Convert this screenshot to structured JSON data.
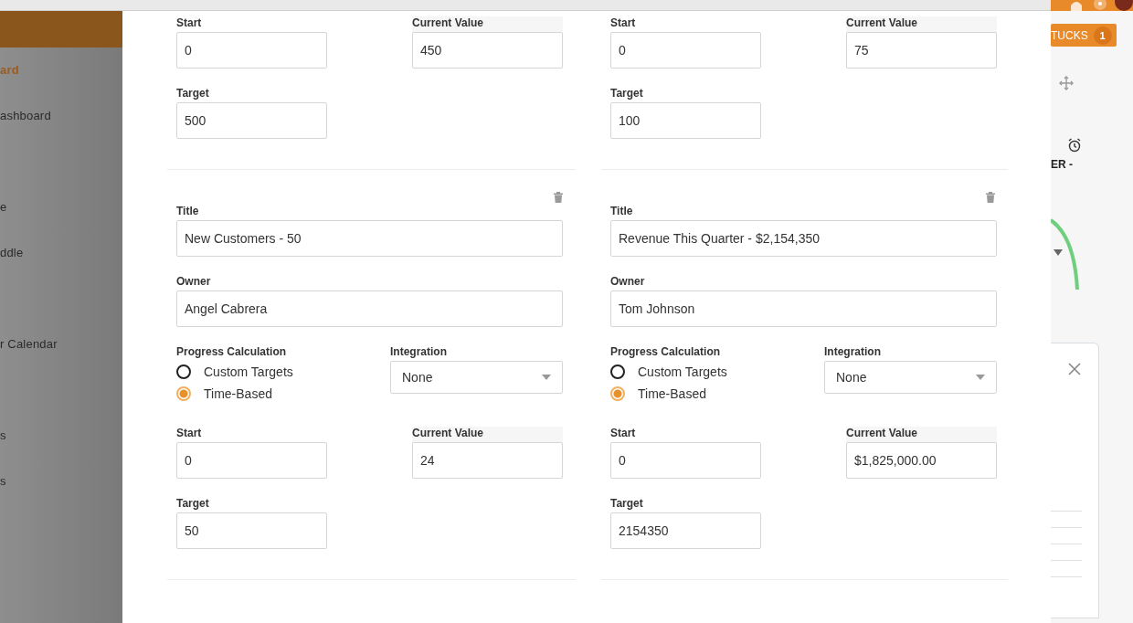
{
  "sidebar": {
    "items": [
      {
        "label": "ard",
        "selected": true
      },
      {
        "label": "ashboard",
        "selected": false
      },
      {
        "label": "e",
        "selected": false
      },
      {
        "label": "ddle",
        "selected": false
      },
      {
        "label": "r Calendar",
        "selected": false
      },
      {
        "label": "s",
        "selected": false
      },
      {
        "label": "s",
        "selected": false
      }
    ]
  },
  "right_panel": {
    "button": {
      "label": "TUCKS",
      "count": "1"
    },
    "heading": "ER -"
  },
  "goals": [
    {
      "start": {
        "label": "Start",
        "value": "0"
      },
      "current": {
        "label": "Current Value",
        "value": "450"
      },
      "target": {
        "label": "Target",
        "value": "500"
      }
    },
    {
      "start": {
        "label": "Start",
        "value": "0"
      },
      "current": {
        "label": "Current Value",
        "value": "75"
      },
      "target": {
        "label": "Target",
        "value": "100"
      }
    },
    {
      "title": {
        "label": "Title",
        "value": "New Customers - 50"
      },
      "owner": {
        "label": "Owner",
        "value": "Angel Cabrera"
      },
      "progress": {
        "label": "Progress Calculation",
        "options": [
          {
            "label": "Custom Targets",
            "selected": false
          },
          {
            "label": "Time-Based",
            "selected": true
          }
        ]
      },
      "integration": {
        "label": "Integration",
        "value": "None"
      },
      "start": {
        "label": "Start",
        "value": "0"
      },
      "current": {
        "label": "Current Value",
        "value": "24"
      },
      "target": {
        "label": "Target",
        "value": "50"
      }
    },
    {
      "title": {
        "label": "Title",
        "value": "Revenue This Quarter - $2,154,350"
      },
      "owner": {
        "label": "Owner",
        "value": "Tom Johnson"
      },
      "progress": {
        "label": "Progress Calculation",
        "options": [
          {
            "label": "Custom Targets",
            "selected": false
          },
          {
            "label": "Time-Based",
            "selected": true
          }
        ]
      },
      "integration": {
        "label": "Integration",
        "value": "None"
      },
      "start": {
        "label": "Start",
        "value": "0"
      },
      "current": {
        "label": "Current Value",
        "value": "$1,825,000.00"
      },
      "target": {
        "label": "Target",
        "value": "2154350"
      }
    }
  ]
}
